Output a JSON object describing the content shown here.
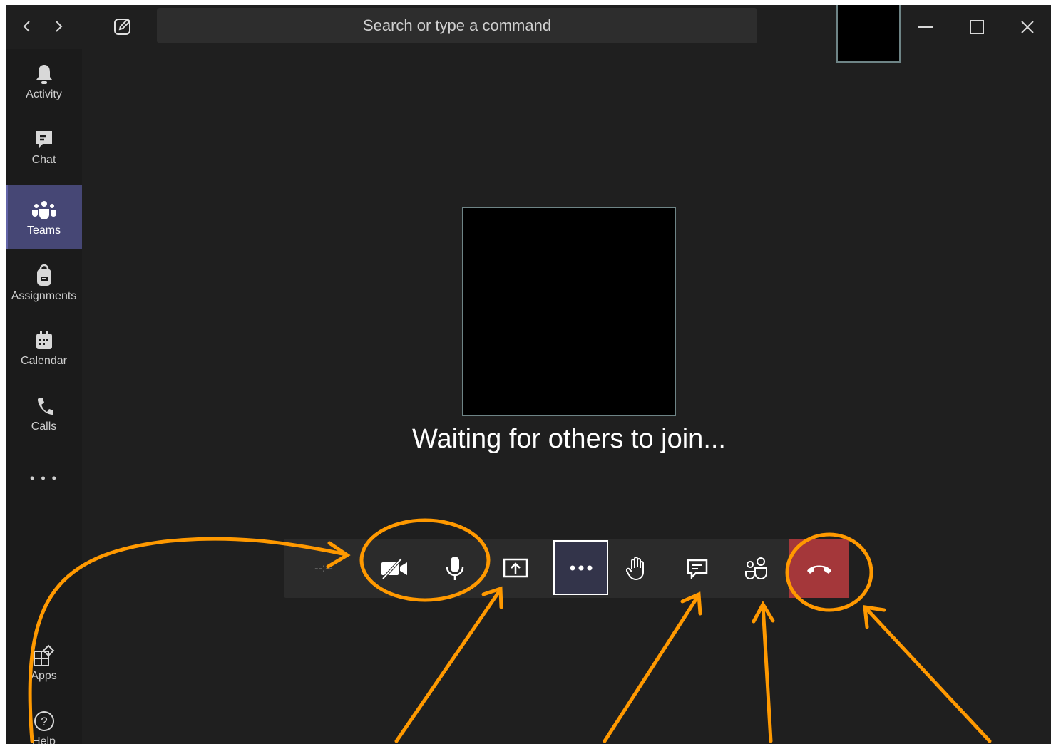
{
  "titlebar": {
    "back_icon": "chevron-left-icon",
    "forward_icon": "chevron-right-icon",
    "compose_icon": "compose-icon",
    "search_placeholder": "Search or type a command",
    "window_controls": [
      "minimize-icon",
      "maximize-icon",
      "close-icon"
    ]
  },
  "rail": {
    "items": [
      {
        "label": "Activity",
        "icon": "bell-icon"
      },
      {
        "label": "Chat",
        "icon": "chat-icon"
      },
      {
        "label": "Teams",
        "icon": "teams-icon",
        "active": true
      },
      {
        "label": "Assignments",
        "icon": "backpack-icon"
      },
      {
        "label": "Calendar",
        "icon": "calendar-icon"
      },
      {
        "label": "Calls",
        "icon": "phone-icon"
      }
    ],
    "more_label": "• • •",
    "apps_label": "Apps",
    "help_label": "Help"
  },
  "stage": {
    "waiting_text": "Waiting for others to join..."
  },
  "controls": {
    "timer": "--:--",
    "buttons": [
      "camera-off-icon",
      "microphone-icon",
      "share-screen-icon",
      "more-options-icon",
      "raise-hand-icon",
      "chat-icon",
      "participants-icon",
      "hang-up-icon"
    ]
  },
  "colors": {
    "background": "#1f1f1f",
    "rail_active": "#464775",
    "hangup": "#a4373a",
    "annotation": "#ff9900"
  }
}
